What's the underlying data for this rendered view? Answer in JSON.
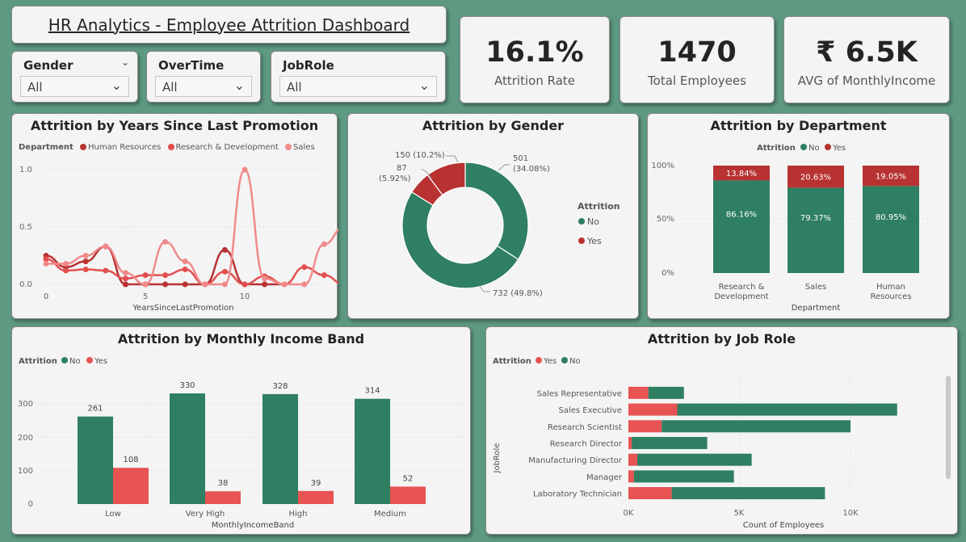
{
  "header": {
    "title": "HR Analytics - Employee Attrition Dashboard"
  },
  "slicers": [
    {
      "label": "Gender",
      "value": "All"
    },
    {
      "label": "OverTime",
      "value": "All"
    },
    {
      "label": "JobRole",
      "value": "All"
    }
  ],
  "kpis": [
    {
      "value": "16.1%",
      "label": "Attrition Rate"
    },
    {
      "value": "1470",
      "label": "Total Employees"
    },
    {
      "value": "₹ 6.5K",
      "label": "AVG of MonthlyIncome"
    }
  ],
  "colors": {
    "no": "#2f7f62",
    "yes": "#e85353",
    "hr": "#b83232",
    "rd": "#e34f4f",
    "sales": "#f08a8a",
    "donut_yes": "#b83232"
  },
  "promotion_chart": {
    "title": "Attrition by Years Since Last Promotion",
    "legend_title": "Department",
    "series_names": [
      "Human Resources",
      "Research & Development",
      "Sales"
    ],
    "xlabel": "YearsSinceLastPromotion",
    "xticks": [
      "0",
      "5",
      "10"
    ],
    "yticks": [
      "1.0",
      "0.5",
      "0.0"
    ],
    "chart_data": {
      "type": "line",
      "x": [
        0,
        1,
        2,
        3,
        4,
        5,
        6,
        7,
        8,
        9,
        10,
        11,
        12,
        13,
        14,
        15
      ],
      "series": [
        {
          "name": "Human Resources",
          "values": [
            0.25,
            0.15,
            0.2,
            0.33,
            0.0,
            0.0,
            0.0,
            0.0,
            0.0,
            0.3,
            0.0,
            0.0,
            0.0,
            null,
            null,
            null
          ]
        },
        {
          "name": "Research & Development",
          "values": [
            0.22,
            0.12,
            0.13,
            0.12,
            0.05,
            0.08,
            0.08,
            0.13,
            0.0,
            0.11,
            0.0,
            0.07,
            0.0,
            0.15,
            0.08,
            0.0
          ]
        },
        {
          "name": "Sales",
          "values": [
            0.18,
            0.18,
            0.25,
            0.33,
            0.1,
            0.0,
            0.37,
            0.2,
            0.0,
            0.0,
            1.0,
            0.05,
            0.0,
            0.0,
            0.35,
            0.5
          ]
        }
      ],
      "ylim": [
        0,
        1.0
      ]
    }
  },
  "gender_chart": {
    "title": "Attrition by Gender",
    "legend_title": "Attrition",
    "legend": [
      "No",
      "Yes"
    ],
    "labels": [
      "501",
      "(34.08%)",
      "732 (49.8%)",
      "150 (10.2%)",
      "87",
      "(5.92%)"
    ],
    "chart_data": {
      "type": "pie",
      "slices": [
        {
          "label": "No",
          "value": 501,
          "pct": 34.08
        },
        {
          "label": "No",
          "value": 732,
          "pct": 49.8
        },
        {
          "label": "Yes",
          "value": 87,
          "pct": 5.92
        },
        {
          "label": "Yes",
          "value": 150,
          "pct": 10.2
        }
      ]
    }
  },
  "dept_chart": {
    "title": "Attrition by Department",
    "legend_title": "Attrition",
    "legend": [
      "No",
      "Yes"
    ],
    "yticks": [
      "100%",
      "50%",
      "0%"
    ],
    "xlabel": "Department",
    "cat_lines": [
      [
        "Research &",
        "Development"
      ],
      [
        "Sales"
      ],
      [
        "Human",
        "Resources"
      ]
    ],
    "chart_data": {
      "type": "bar",
      "categories": [
        "Research & Development",
        "Sales",
        "Human Resources"
      ],
      "series": [
        {
          "name": "No",
          "values": [
            86.16,
            79.37,
            80.95
          ],
          "labels": [
            "86.16%",
            "79.37%",
            "80.95%"
          ]
        },
        {
          "name": "Yes",
          "values": [
            13.84,
            20.63,
            19.05
          ],
          "labels": [
            "13.84%",
            "20.63%",
            "19.05%"
          ]
        }
      ],
      "ylim": [
        0,
        100
      ]
    }
  },
  "income_chart": {
    "title": "Attrition by Monthly Income Band",
    "legend_title": "Attrition",
    "legend": [
      "No",
      "Yes"
    ],
    "xlabel": "MonthlyIncomeBand",
    "yticks": [
      "300",
      "200",
      "100",
      "0"
    ],
    "chart_data": {
      "type": "bar",
      "categories": [
        "Low",
        "Very High",
        "High",
        "Medium"
      ],
      "series": [
        {
          "name": "No",
          "values": [
            261,
            330,
            328,
            314
          ]
        },
        {
          "name": "Yes",
          "values": [
            108,
            38,
            39,
            52
          ]
        }
      ],
      "ylim": [
        0,
        350
      ]
    }
  },
  "jobrole_chart": {
    "title": "Attrition by Job Role",
    "legend_title": "Attrition",
    "legend": [
      "Yes",
      "No"
    ],
    "ylabel": "JobRole",
    "xlabel": "Count of Employees",
    "xticks": [
      "0K",
      "5K",
      "10K"
    ],
    "chart_data": {
      "type": "bar",
      "categories": [
        "Sales Representative",
        "Sales Executive",
        "Research Scientist",
        "Research Director",
        "Manufacturing Director",
        "Manager",
        "Laboratory Technician"
      ],
      "series": [
        {
          "name": "Yes",
          "values": [
            900,
            2200,
            1500,
            150,
            400,
            250,
            1950
          ]
        },
        {
          "name": "No",
          "values": [
            1600,
            9900,
            8500,
            3400,
            5150,
            4500,
            6900
          ]
        }
      ],
      "xlim": [
        0,
        12000
      ]
    }
  }
}
